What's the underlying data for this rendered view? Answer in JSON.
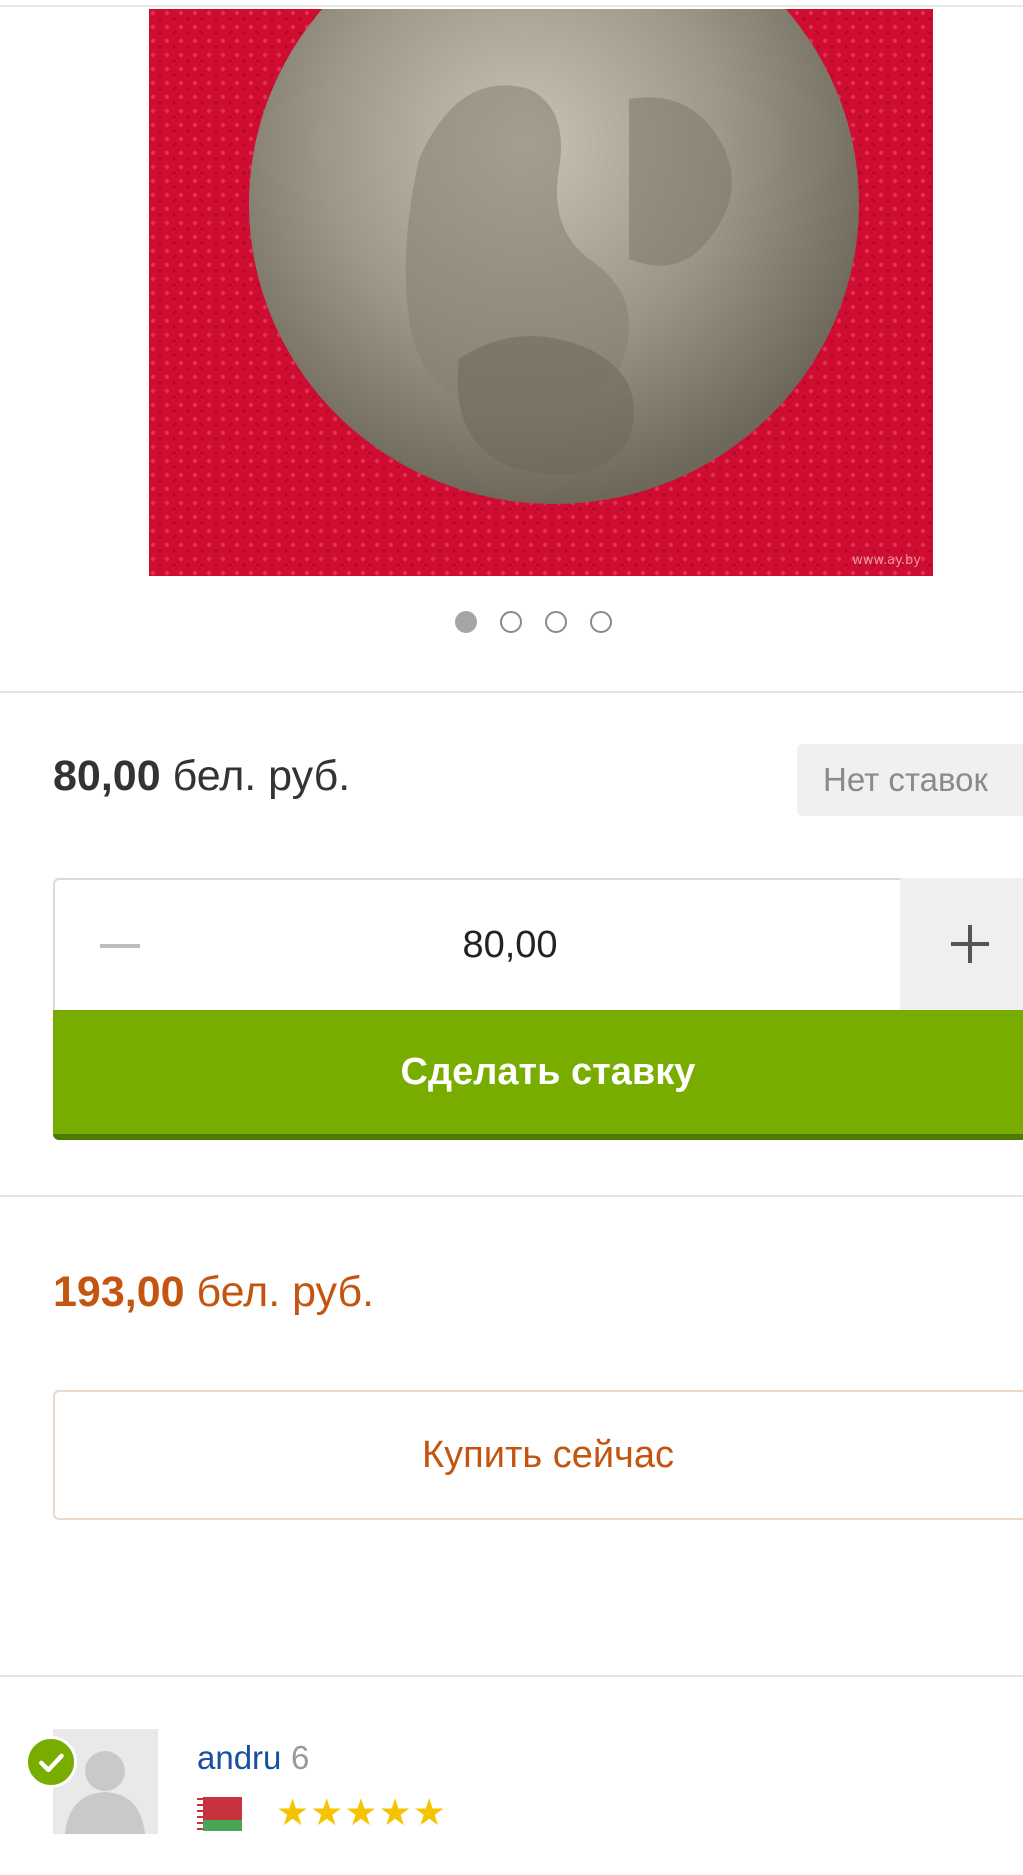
{
  "gallery": {
    "watermark": "www.ay.by",
    "dots": 4,
    "active_index": 0
  },
  "auction": {
    "price_number": "80,00",
    "price_currency": "бел. руб.",
    "bids_status": "Нет ставок",
    "bid_input_value": "80,00",
    "bid_button_label": "Сделать ставку"
  },
  "buy_now": {
    "price_number": "193,00",
    "price_currency": "бел. руб.",
    "button_label": "Купить сейчас"
  },
  "seller": {
    "name": "andru",
    "score": "6",
    "rating_stars": 5,
    "stars_text": "★★★★★",
    "flag": "belarus-flag-icon",
    "verified": true
  },
  "colors": {
    "accent_green": "#78ad00",
    "buy_orange": "#c45510",
    "link_blue": "#1a4fa0",
    "star_yellow": "#f5c400"
  }
}
